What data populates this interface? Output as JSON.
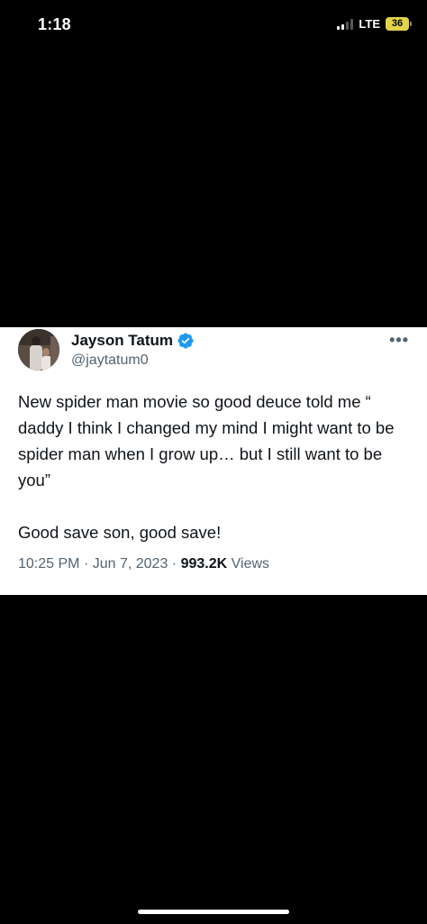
{
  "status_bar": {
    "time": "1:18",
    "network": "LTE",
    "battery": "36"
  },
  "tweet": {
    "author_name": "Jayson Tatum",
    "handle": "@jaytatum0",
    "verified": true,
    "text_paragraph_1": "New spider man movie so good deuce told me “ daddy I think I changed my mind I might want to be spider man when I grow up… but I still want to be you”",
    "text_paragraph_2": "Good save son, good save!",
    "time": "10:25 PM",
    "separator": "·",
    "date": "Jun 7, 2023",
    "views_count": "993.2K",
    "views_label": "Views",
    "more_label": "•••"
  },
  "colors": {
    "background": "#000000",
    "card": "#ffffff",
    "text_primary": "#0f1419",
    "text_secondary": "#536471",
    "verified_blue": "#1d9bf0",
    "battery": "#e2d44a"
  },
  "icons": {
    "verified": "verified-badge-icon",
    "signal": "signal-bars-icon",
    "battery": "battery-icon",
    "more": "more-options-icon"
  }
}
